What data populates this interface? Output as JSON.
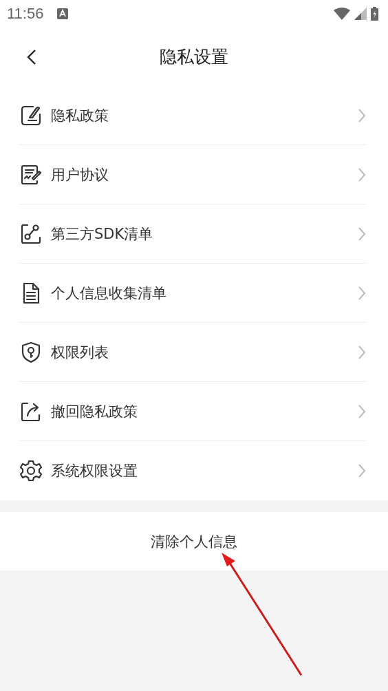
{
  "status_bar": {
    "time": "11:56"
  },
  "header": {
    "title": "隐私设置"
  },
  "menu_items": [
    {
      "label": "隐私政策"
    },
    {
      "label": "用户协议"
    },
    {
      "label": "第三方SDK清单"
    },
    {
      "label": "个人信息收集清单"
    },
    {
      "label": "权限列表"
    },
    {
      "label": "撤回隐私政策"
    },
    {
      "label": "系统权限设置"
    }
  ],
  "clear_button": {
    "label": "清除个人信息"
  }
}
